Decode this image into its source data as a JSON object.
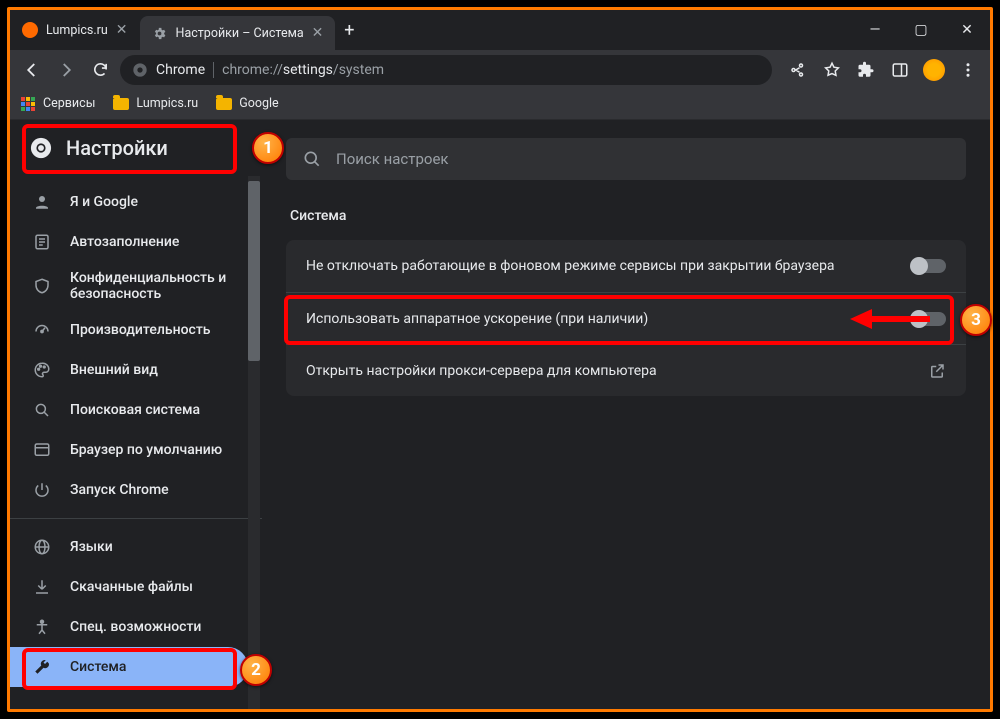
{
  "window": {
    "tabs": [
      {
        "title": "Lumpics.ru",
        "favicon": "orange-dot",
        "active": false
      },
      {
        "title": "Настройки – Система",
        "favicon": "gear",
        "active": true
      }
    ],
    "controls": {
      "minimize": "—",
      "maximize": "▢",
      "close": "✕"
    }
  },
  "toolbar": {
    "secure_label": "Chrome",
    "url_prefix": "chrome://",
    "url_bold": "settings",
    "url_suffix": "/system"
  },
  "bookmarks": [
    {
      "icon": "apps",
      "label": "Сервисы"
    },
    {
      "icon": "folder",
      "label": "Lumpics.ru"
    },
    {
      "icon": "folder",
      "label": "Google"
    }
  ],
  "sidebar": {
    "title": "Настройки",
    "items": [
      {
        "icon": "person",
        "label": "Я и Google"
      },
      {
        "icon": "autofill",
        "label": "Автозаполнение"
      },
      {
        "icon": "shield",
        "label": "Конфиденциальность и безопасность",
        "multiline": true
      },
      {
        "icon": "speed",
        "label": "Производительность"
      },
      {
        "icon": "palette",
        "label": "Внешний вид"
      },
      {
        "icon": "search",
        "label": "Поисковая система"
      },
      {
        "icon": "browser",
        "label": "Браузер по умолчанию"
      },
      {
        "icon": "power",
        "label": "Запуск Chrome"
      }
    ],
    "items2": [
      {
        "icon": "globe",
        "label": "Языки"
      },
      {
        "icon": "download",
        "label": "Скачанные файлы"
      },
      {
        "icon": "access",
        "label": "Спец. возможности"
      },
      {
        "icon": "wrench",
        "label": "Система",
        "selected": true
      }
    ]
  },
  "main": {
    "search_placeholder": "Поиск настроек",
    "section_title": "Система",
    "rows": [
      {
        "label": "Не отключать работающие в фоновом режиме сервисы при закрытии браузера",
        "kind": "toggle",
        "on": false
      },
      {
        "label": "Использовать аппаратное ускорение (при наличии)",
        "kind": "toggle",
        "on": false
      },
      {
        "label": "Открыть настройки прокси-сервера для компьютера",
        "kind": "link"
      }
    ]
  },
  "annotations": {
    "b1": "1",
    "b2": "2",
    "b3": "3"
  }
}
